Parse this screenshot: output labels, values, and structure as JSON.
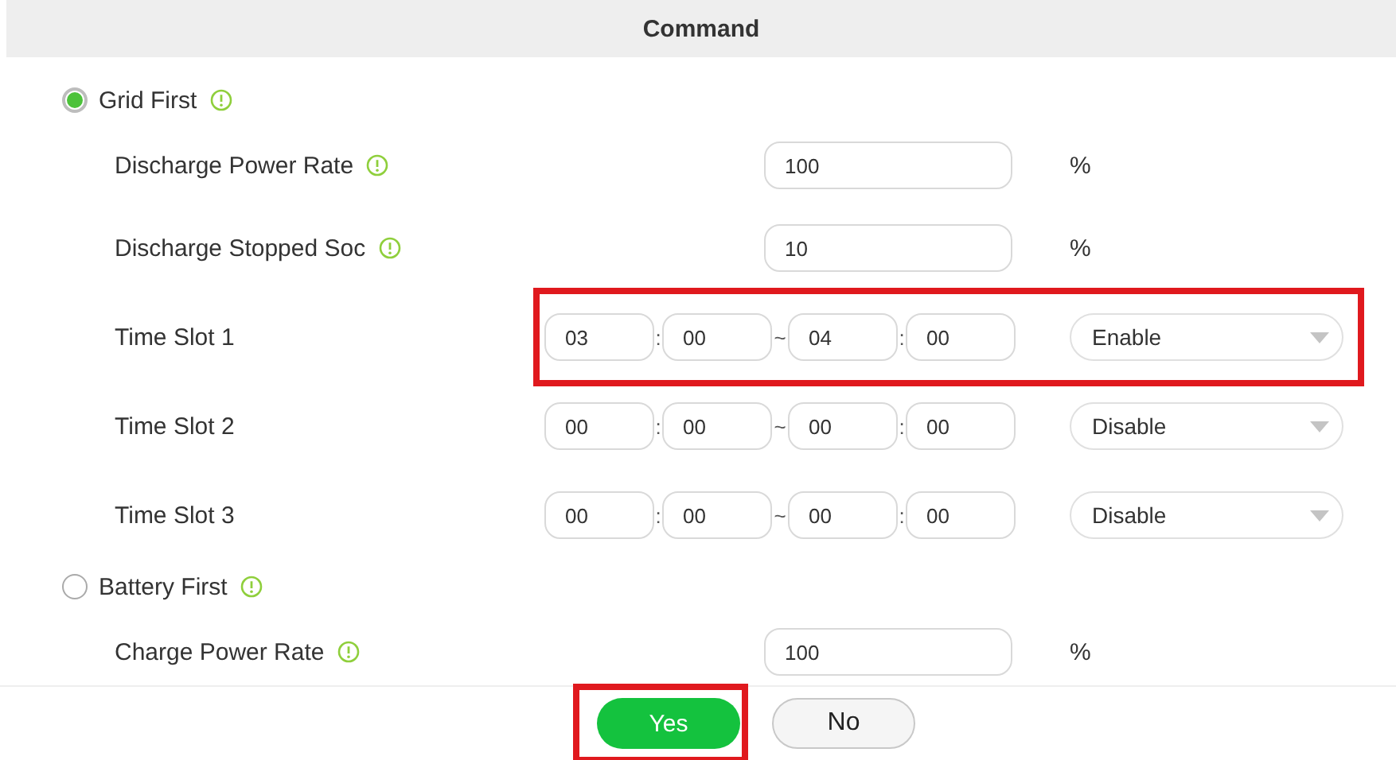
{
  "header": {
    "title": "Command"
  },
  "modes": [
    {
      "label": "Grid First",
      "selected": true,
      "fields": [
        {
          "kind": "number",
          "label": "Discharge Power Rate",
          "value": "100",
          "unit": "%"
        },
        {
          "kind": "number",
          "label": "Discharge Stopped Soc",
          "value": "10",
          "unit": "%"
        },
        {
          "kind": "timeslot",
          "label": "Time Slot 1",
          "highlighted": true,
          "pieces": [
            {
              "kind": "field",
              "text": "03"
            },
            {
              "kind": "sep",
              "text": ":"
            },
            {
              "kind": "field",
              "text": "00"
            },
            {
              "kind": "sep",
              "text": "~"
            },
            {
              "kind": "field",
              "text": "04"
            },
            {
              "kind": "sep",
              "text": ":"
            },
            {
              "kind": "field",
              "text": "00"
            }
          ],
          "select": "Enable"
        },
        {
          "kind": "timeslot",
          "label": "Time Slot 2",
          "highlighted": false,
          "pieces": [
            {
              "kind": "field",
              "text": "00"
            },
            {
              "kind": "sep",
              "text": ":"
            },
            {
              "kind": "field",
              "text": "00"
            },
            {
              "kind": "sep",
              "text": "~"
            },
            {
              "kind": "field",
              "text": "00"
            },
            {
              "kind": "sep",
              "text": ":"
            },
            {
              "kind": "field",
              "text": "00"
            }
          ],
          "select": "Disable"
        },
        {
          "kind": "timeslot",
          "label": "Time Slot 3",
          "highlighted": false,
          "pieces": [
            {
              "kind": "field",
              "text": "00"
            },
            {
              "kind": "sep",
              "text": ":"
            },
            {
              "kind": "field",
              "text": "00"
            },
            {
              "kind": "sep",
              "text": "~"
            },
            {
              "kind": "field",
              "text": "00"
            },
            {
              "kind": "sep",
              "text": ":"
            },
            {
              "kind": "field",
              "text": "00"
            }
          ],
          "select": "Disable"
        }
      ]
    },
    {
      "label": "Battery First",
      "selected": false,
      "fields": [
        {
          "kind": "number",
          "label": "Charge Power Rate",
          "value": "100",
          "unit": "%"
        }
      ]
    }
  ],
  "buttons": [
    {
      "label": "Yes",
      "kind": "primary",
      "highlighted": true
    },
    {
      "label": "No",
      "kind": "secondary",
      "highlighted": false
    }
  ]
}
